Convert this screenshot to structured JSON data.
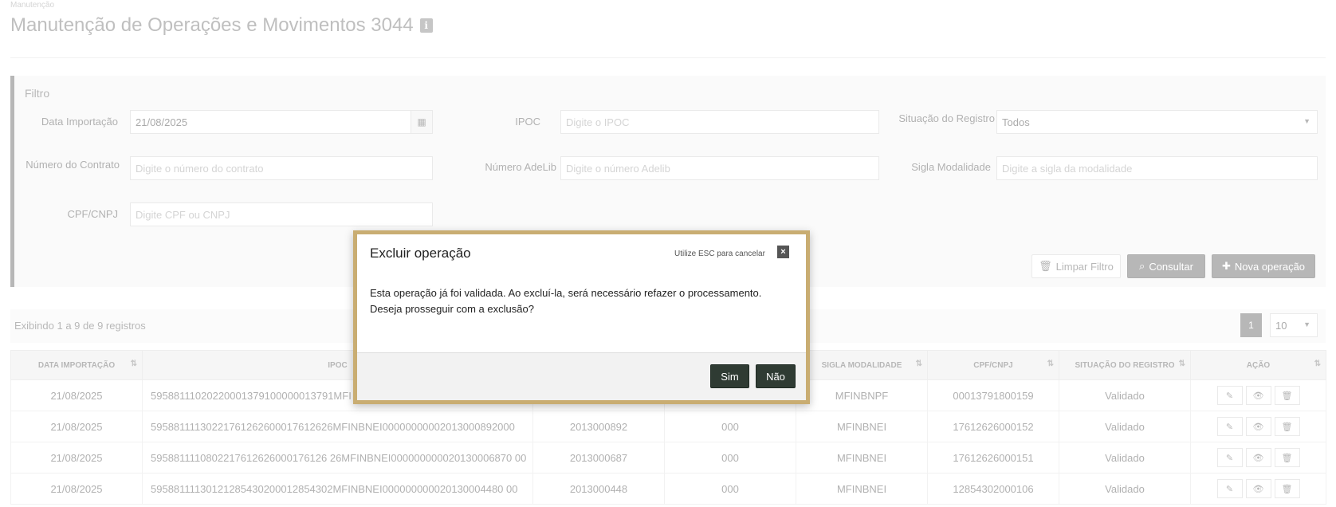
{
  "breadcrumb": "Manutenção",
  "page_title": "Manutenção de Operações e Movimentos 3044",
  "info_badge": "i",
  "filter": {
    "title": "Filtro",
    "data_importacao": {
      "label": "Data Importação",
      "value": "21/08/2025"
    },
    "ipoc": {
      "label": "IPOC",
      "placeholder": "Digite o IPOC"
    },
    "situacao": {
      "label": "Situação do Registro",
      "value": "Todos"
    },
    "numero_contrato": {
      "label": "Número do Contrato",
      "placeholder": "Digite o número do contrato"
    },
    "numero_adelib": {
      "label": "Número AdeLib",
      "placeholder": "Digite o número Adelib"
    },
    "sigla_modalidade": {
      "label": "Sigla Modalidade",
      "placeholder": "Digite a sigla da modalidade"
    },
    "cpf_cnpj": {
      "label": "CPF/CNPJ",
      "placeholder": "Digite CPF ou CNPJ"
    },
    "btn_limpar": "Limpar Filtro",
    "btn_consultar": "Consultar",
    "btn_nova": "Nova operação"
  },
  "records": {
    "text": "Exibindo 1 a 9 de 9 registros",
    "page": "1",
    "page_size": "10"
  },
  "table": {
    "headers": [
      "DATA IMPORTAÇÃO",
      "IPOC",
      "",
      "",
      "SIGLA MODALIDADE",
      "CPF/CNPJ",
      "SITUAÇÃO DO REGISTRO",
      "AÇÃO"
    ],
    "rows": [
      [
        "21/08/2025",
        "59588111020220001379100000013791MFI",
        "",
        "",
        "MFINBNPF",
        "00013791800159",
        "Validado"
      ],
      [
        "21/08/2025",
        "59588111130221761262600017612626MFINBNEI0000000000201300089200​0",
        "2013000892",
        "000",
        "MFINBNEI",
        "17612626000152",
        "Validado"
      ],
      [
        "21/08/2025",
        "5958811110802217612626000176126 26MFINBNEI000000000020130006870 00",
        "2013000687",
        "000",
        "MFINBNEI",
        "17612626000151",
        "Validado"
      ],
      [
        "21/08/2025",
        "59588111130121285430200012854302MFINBNEI000000000020130004480 00",
        "2013000448",
        "000",
        "MFINBNEI",
        "12854302000106",
        "Validado"
      ]
    ]
  },
  "modal": {
    "title": "Excluir operação",
    "hint": "Utilize ESC para cancelar",
    "close": "×",
    "line1": "Esta operação já foi validada. Ao excluí-la, será necessário refazer o processamento.",
    "line2": "Deseja prosseguir com a exclusão?",
    "btn_sim": "Sim",
    "btn_nao": "Não"
  }
}
